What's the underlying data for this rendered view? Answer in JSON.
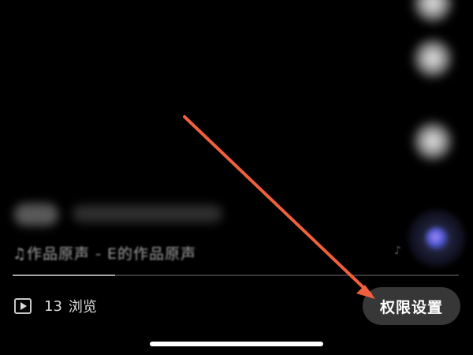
{
  "music": {
    "caption": "♫作品原声 - E的作品原声",
    "note_icon": "music-note-icon"
  },
  "progress": {
    "fraction": 0.23
  },
  "stats": {
    "views_count": "13",
    "views_label": "浏览",
    "views_icon": "play-box-icon"
  },
  "permission_button": {
    "label": "权限设置"
  },
  "annotation": {
    "arrow_color": "#f0603d"
  },
  "colors": {
    "background": "#000000",
    "button_bg": "#3a3a3a",
    "text": "#ffffff"
  }
}
